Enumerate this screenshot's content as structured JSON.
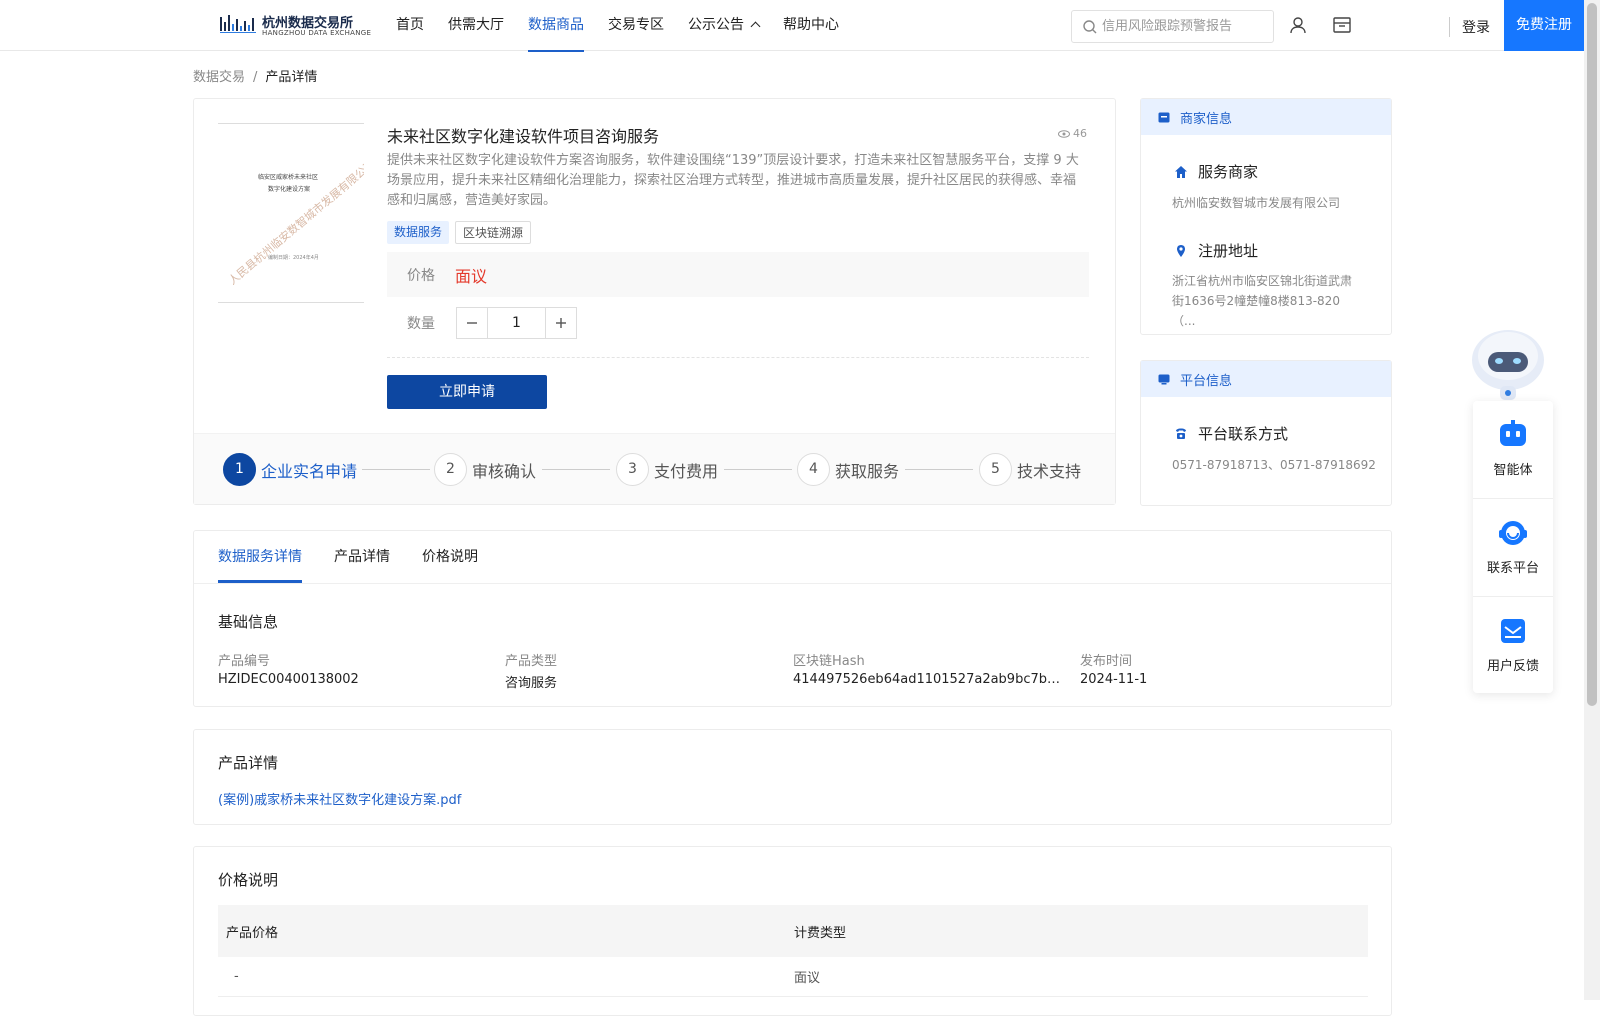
{
  "header": {
    "logo_cn": "杭州数据交易所",
    "logo_en": "HANGZHOU DATA EXCHANGE",
    "nav": [
      "首页",
      "供需大厅",
      "数据商品",
      "交易专区",
      "公示公告",
      "帮助中心"
    ],
    "active_nav": "数据商品",
    "search_placeholder": "信用风险跟踪预警报告",
    "login": "登录",
    "register": "免费注册"
  },
  "breadcrumb": {
    "root": "数据交易",
    "separator": "/",
    "current": "产品详情"
  },
  "product": {
    "title": "未来社区数字化建设软件项目咨询服务",
    "views": "46",
    "description": "提供未来社区数字化建设软件方案咨询服务，软件建设围绕“139”顶层设计要求，打造未来社区智慧服务平台，支撑 9 大场景应用，提升未来社区精细化治理能力，探索社区治理方式转型，推进城市高质量发展，提升社区居民的获得感、幸福感和归属感，营造美好家园。",
    "tags": [
      "数据服务",
      "区块链溯源"
    ],
    "price_label": "价格",
    "price_value": "面议",
    "qty_label": "数量",
    "qty_value": "1",
    "apply_button": "立即申请",
    "thumbnail": {
      "line1": "临安区威家桥未来社区",
      "line2": "数字化建设方案",
      "footer": "编制日期：2024年4月",
      "watermark": "人民县杭州临安数智城市发展有限公司"
    }
  },
  "steps": [
    {
      "num": "1",
      "label": "企业实名申请"
    },
    {
      "num": "2",
      "label": "审核确认"
    },
    {
      "num": "3",
      "label": "支付费用"
    },
    {
      "num": "4",
      "label": "获取服务"
    },
    {
      "num": "5",
      "label": "技术支持"
    }
  ],
  "merchant": {
    "title": "商家信息",
    "service_label": "服务商家",
    "service_value": "杭州临安数智城市发展有限公司",
    "address_label": "注册地址",
    "address_value": "浙江省杭州市临安区锦北街道武肃街1636号2幢楚幢8楼813-820（..."
  },
  "platform": {
    "title": "平台信息",
    "contact_label": "平台联系方式",
    "contact_value": "0571-87918713、0571-87918692"
  },
  "tabs": [
    "数据服务详情",
    "产品详情",
    "价格说明"
  ],
  "basic_info": {
    "title": "基础信息",
    "fields": [
      {
        "label": "产品编号",
        "value": "HZIDEC00400138002"
      },
      {
        "label": "产品类型",
        "value": "咨询服务"
      },
      {
        "label": "区块链Hash",
        "value": "414497526eb64ad1101527a2ab9bc7b4f7..."
      },
      {
        "label": "发布时间",
        "value": "2024-11-1"
      }
    ]
  },
  "product_detail": {
    "title": "产品详情",
    "file": "(案例)戚家桥未来社区数字化建设方案.pdf"
  },
  "price_info": {
    "title": "价格说明",
    "headers": [
      "产品价格",
      "计费类型"
    ],
    "rows": [
      [
        "-",
        "面议"
      ]
    ]
  },
  "float_panel": [
    "智能体",
    "联系平台",
    "用户反馈"
  ],
  "colors": {
    "primary": "#1d5fc9",
    "button": "#0d47a1",
    "price": "#e4392b",
    "register": "#1677ff"
  }
}
